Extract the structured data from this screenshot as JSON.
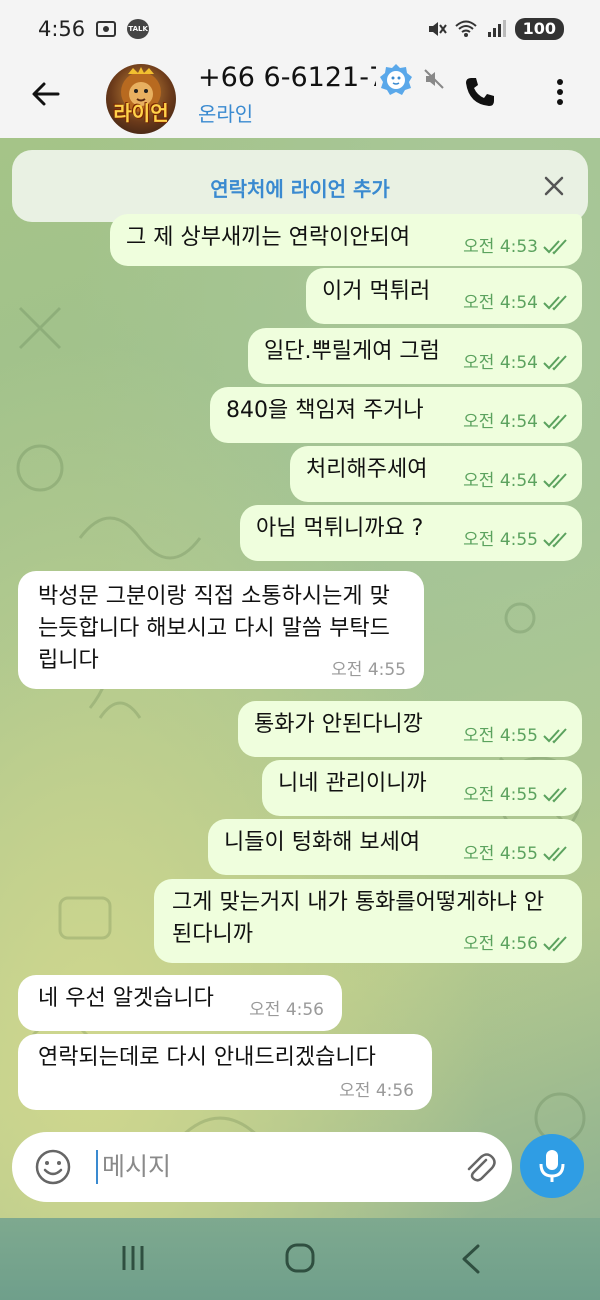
{
  "status_bar": {
    "time": "4:56",
    "battery": "100",
    "talk_badge": "TALK"
  },
  "header": {
    "contact_name": "+66 6-6121-7",
    "status": "온라인",
    "avatar_text": "라이언"
  },
  "banner": {
    "label": "연락처에 라이언 추가"
  },
  "messages": [
    {
      "text": "그 제 상부새끼는 연락이안되여",
      "time": "오전 4:53",
      "dir": "out"
    },
    {
      "text": "이거 먹튀러",
      "time": "오전 4:54",
      "dir": "out"
    },
    {
      "text": "일단.뿌릴게여 그럼",
      "time": "오전 4:54",
      "dir": "out"
    },
    {
      "text": "840을 책임져 주거나",
      "time": "오전 4:54",
      "dir": "out"
    },
    {
      "text": "처리해주세여",
      "time": "오전 4:54",
      "dir": "out"
    },
    {
      "text": "아님 먹튀니까요 ?",
      "time": "오전 4:55",
      "dir": "out"
    },
    {
      "text": "박성문 그분이랑 직접 소통하시는게 맞는듯합니다 해보시고 다시 말씀 부탁드립니다",
      "time": "오전 4:55",
      "dir": "in"
    },
    {
      "text": "통화가 안된다니깡",
      "time": "오전 4:55",
      "dir": "out"
    },
    {
      "text": "니네 관리이니까",
      "time": "오전 4:55",
      "dir": "out"
    },
    {
      "text": "니들이 텅화해 보세여",
      "time": "오전 4:55",
      "dir": "out"
    },
    {
      "text": "그게 맞는거지 내가 통화를어떻게하냐 안된다니까",
      "time": "오전 4:56",
      "dir": "out"
    },
    {
      "text": "네 우선 알겟습니다",
      "time": "오전 4:56",
      "dir": "in"
    },
    {
      "text": "연락되는데로 다시 안내드리겠습니다",
      "time": "오전 4:56",
      "dir": "in"
    }
  ],
  "composer": {
    "placeholder": "메시지"
  },
  "colors": {
    "accent": "#3a8ad0",
    "outgoing_bubble": "#effedd",
    "incoming_bubble": "#ffffff",
    "read_check": "#5ba25e",
    "mic_button": "#2f9de4"
  },
  "icons": {
    "back": "arrow-left-icon",
    "verified": "lion-badge-icon",
    "muted": "speaker-muted-icon",
    "call": "phone-icon",
    "menu": "kebab-menu-icon",
    "close": "close-icon",
    "emoji": "smiley-icon",
    "attach": "paperclip-icon",
    "mic": "microphone-icon"
  }
}
